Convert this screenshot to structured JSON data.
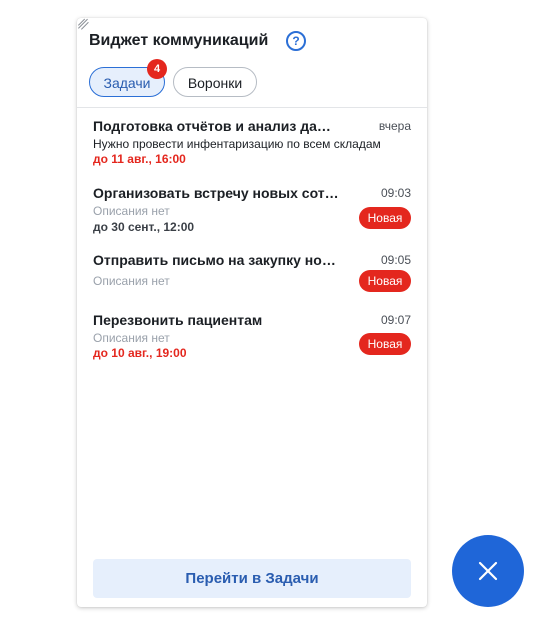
{
  "widget": {
    "title": "Виджет коммуникаций",
    "help_icon": "question-circle-icon",
    "help_glyph": "?",
    "tabs": [
      {
        "label": "Задачи",
        "badge": "4",
        "active": true
      },
      {
        "label": "Воронки",
        "active": false
      }
    ],
    "tasks": [
      {
        "title": "Подготовка отчётов и анализ данных",
        "time": "вчера",
        "description": "Нужно провести инфентаризацию по всем складам",
        "due": "до 11 авг., 16:00",
        "due_overdue": true
      },
      {
        "title": "Организовать встречу новых сотрудников",
        "time": "09:03",
        "description": "Описания нет",
        "due": "до 30 сент., 12:00",
        "due_overdue": false,
        "status": "Новая"
      },
      {
        "title": "Отправить письмо на закупку новых материалов",
        "time": "09:05",
        "description": "Описания нет",
        "status": "Новая"
      },
      {
        "title": "Перезвонить пациентам",
        "time": "09:07",
        "description": "Описания нет",
        "due": "до 10 авг., 19:00",
        "due_overdue": true,
        "status": "Новая"
      }
    ],
    "go_button_label": "Перейти в Задачи"
  },
  "fab": {
    "icon": "close-icon"
  },
  "colors": {
    "accent": "#1f66d8",
    "accent_soft": "#e6effc",
    "danger": "#e4271e",
    "muted_text": "#9aa1ab"
  }
}
